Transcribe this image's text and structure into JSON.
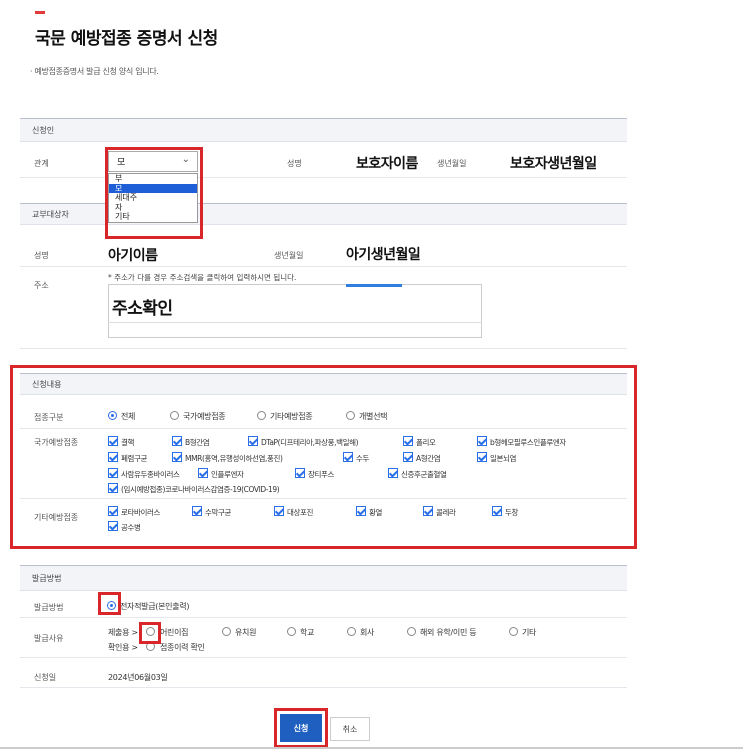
{
  "page": {
    "title": "국문 예방접종 증명서 신청",
    "description": "· 예방접종증명서 발급 신청 양식 입니다."
  },
  "applicant": {
    "section_title": "신청인",
    "relation_label": "관계",
    "relation_value": "모",
    "relation_options": [
      "부",
      "모",
      "세대주",
      "자",
      "기타"
    ],
    "relation_selected_index": 1,
    "name_label": "성명",
    "name_value": "보호자이름",
    "birth_label": "생년월일",
    "birth_value": "보호자생년월일"
  },
  "subject": {
    "section_title": "교부대상자",
    "name_label": "성명",
    "name_value": "아기이름",
    "birth_label": "생년월일",
    "birth_value": "아기생년월일",
    "address_label": "주소",
    "address_note": "* 주소가 다를 경우 주소검색을 클릭하여 입력하시면 됩니다.",
    "address_value": "주소확인"
  },
  "request": {
    "section_title": "신청내용",
    "type_label": "접종구분",
    "type_options": [
      "전체",
      "국가예방접종",
      "기타예방접종",
      "개별선택"
    ],
    "type_selected_index": 0,
    "national_label": "국가예방접종",
    "national_items": [
      "결핵",
      "B형간염",
      "DTaP(디프테리아,파상풍,백일해)",
      "폴리오",
      "b형헤모필루스인플루엔자",
      "폐렴구균",
      "MMR(홍역,유행성이하선염,풍진)",
      "수두",
      "A형간염",
      "일본뇌염",
      "사람유두종바이러스",
      "인플루엔자",
      "장티푸스",
      "신증후군출혈열",
      "(임시예방접종)코로나바이러스감염증-19(COVID-19)"
    ],
    "other_label": "기타예방접종",
    "other_items": [
      "로타바이러스",
      "수막구균",
      "대상포진",
      "황열",
      "콜레라",
      "두창",
      "공수병"
    ]
  },
  "issuance": {
    "section_title": "발급방법",
    "method_label": "발급방법",
    "method_value": "전자적발급(본인출력)",
    "reason_label": "발급사유",
    "reason_prefix1": "제출용 >",
    "reason_options": [
      "어린이집",
      "유치원",
      "학교",
      "회사",
      "해외 유학/이민 등",
      "기타"
    ],
    "reason_prefix2": "확인용 >",
    "reason_option2": "접종이력 확인",
    "date_label": "신청일",
    "date_value": "2024년06월03일"
  },
  "actions": {
    "submit_label": "신청",
    "cancel_label": "취소"
  },
  "colors": {
    "accent_red": "#d9262b",
    "primary_blue": "#1f5fbf",
    "check_blue": "#2a6ee8"
  }
}
